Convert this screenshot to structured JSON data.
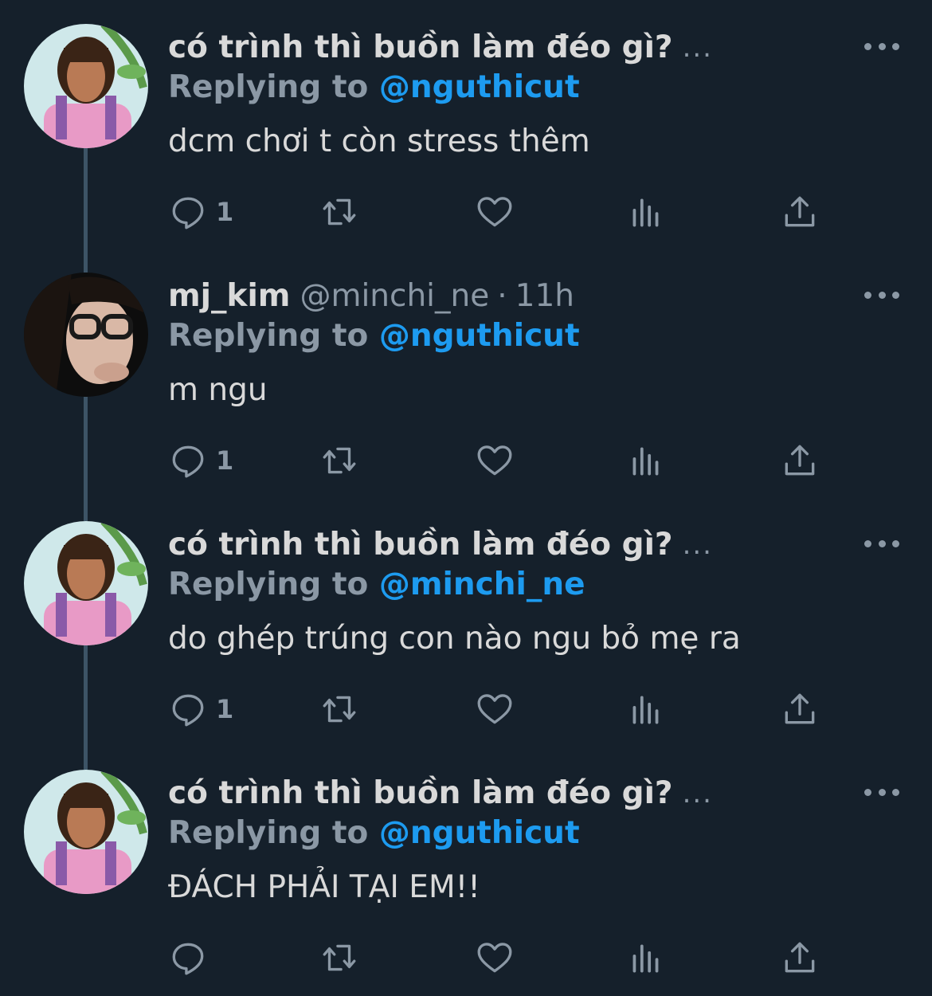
{
  "tweets": [
    {
      "name": "có trình thì buồn làm đéo gì?",
      "name_truncation": "...",
      "replying_label": "Replying to",
      "replying_to": "@nguthicut",
      "text": "dcm chơi t còn stress thêm",
      "reply_count": "1",
      "avatar": "dwayne-dora-avatar"
    },
    {
      "name": "mj_kim",
      "handle": "@minchi_ne",
      "separator": "·",
      "time": "11h",
      "replying_label": "Replying to",
      "replying_to": "@nguthicut",
      "text": "m ngu",
      "reply_count": "1",
      "avatar": "girl-glasses-avatar"
    },
    {
      "name": "có trình thì buồn làm đéo gì?",
      "name_truncation": "...",
      "replying_label": "Replying to",
      "replying_to": "@minchi_ne",
      "text": "do ghép trúng con nào ngu bỏ mẹ ra",
      "reply_count": "1",
      "avatar": "dwayne-dora-avatar"
    },
    {
      "name": "có trình thì buồn làm đéo gì?",
      "name_truncation": "...",
      "replying_label": "Replying to",
      "replying_to": "@nguthicut",
      "text": "ĐÁCH PHẢI TẠI EM!!",
      "reply_count": "",
      "avatar": "dwayne-dora-avatar"
    }
  ],
  "colors": {
    "background": "#15202b",
    "text": "#d9d9d9",
    "muted": "#8b98a5",
    "accent": "#1d9bf0",
    "thread_line": "#3d5466"
  },
  "icons": [
    "reply-icon",
    "retweet-icon",
    "like-icon",
    "views-icon",
    "share-icon",
    "more-icon"
  ]
}
